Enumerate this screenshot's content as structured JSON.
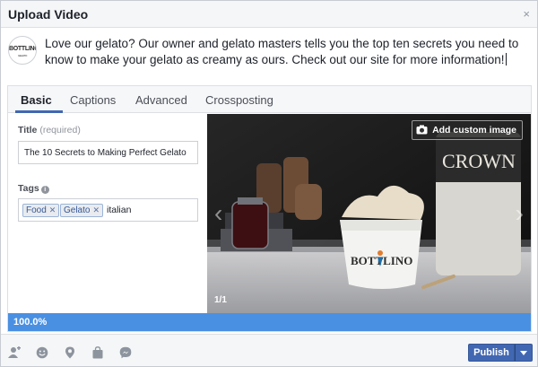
{
  "dialog": {
    "title": "Upload Video",
    "close_glyph": "×"
  },
  "composer": {
    "avatar_brand": "BOTTLINO",
    "avatar_sub": "GELATO",
    "text": "Love our gelato? Our owner and gelato masters tells you the top ten secrets you need to know to make your gelato as creamy as ours. Check out our site for more information!"
  },
  "tabs": [
    {
      "label": "Basic",
      "active": true
    },
    {
      "label": "Captions",
      "active": false
    },
    {
      "label": "Advanced",
      "active": false
    },
    {
      "label": "Crossposting",
      "active": false
    }
  ],
  "form": {
    "title_label": "Title",
    "title_required": "(required)",
    "title_value": "The 10 Secrets to Making Perfect Gelato",
    "tags_label": "Tags",
    "tags": [
      "Food",
      "Gelato"
    ],
    "tag_typed": "italian"
  },
  "preview": {
    "custom_image_label": "Add custom image",
    "counter": "1/1",
    "cup_brand": "BOTTLINO",
    "bottle_text": "CROWN"
  },
  "progress": {
    "label": "100.0%",
    "value": 1.0
  },
  "footer": {
    "icons": [
      "tag-people-icon",
      "feeling-icon",
      "location-icon",
      "shopping-bag-icon",
      "messenger-icon"
    ],
    "publish_label": "Publish"
  },
  "colors": {
    "accent": "#4267b2",
    "progress": "#4a90e2"
  }
}
